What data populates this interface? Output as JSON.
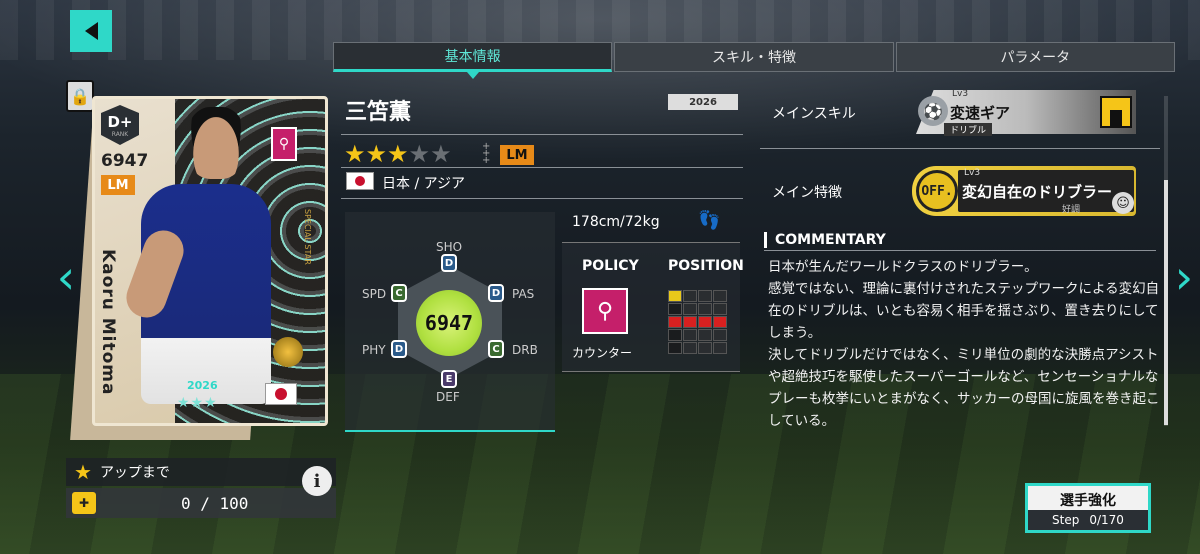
{
  "tabs": [
    {
      "label": "基本情報",
      "active": true
    },
    {
      "label": "スキル・特徴",
      "active": false
    },
    {
      "label": "パラメータ",
      "active": false
    }
  ],
  "card": {
    "rank": "D+",
    "rank_label": "RANK",
    "ovr": "6947",
    "position": "LM",
    "name": "Kaoru Mitoma",
    "year": "2026",
    "stars": "★★★",
    "special_text": "SPECIAL STAR"
  },
  "upgrade": {
    "label": "アップまで",
    "value": "0 / 100",
    "info": "i"
  },
  "player": {
    "name": "三笘薫",
    "year": "2026",
    "stars_filled": 3,
    "stars_total": 5,
    "position": "LM",
    "nation": "日本 / アジア",
    "height_weight": "178cm/72kg"
  },
  "stats": {
    "ovr": "6947",
    "labels": {
      "sho": "SHO",
      "pas": "PAS",
      "drb": "DRB",
      "def": "DEF",
      "phy": "PHY",
      "spd": "SPD"
    },
    "grades": {
      "sho": "D",
      "pas": "D",
      "drb": "C",
      "def": "E",
      "phy": "D",
      "spd": "C"
    }
  },
  "policy": {
    "header": "POLICY",
    "name": "カウンター"
  },
  "position_map": {
    "header": "POSITION"
  },
  "main_skill": {
    "label": "メインスキル",
    "level": "Lv3",
    "name": "変速ギア",
    "category": "ドリブル"
  },
  "main_trait": {
    "label": "メイン特徴",
    "badge": "OFF.",
    "level": "Lv3",
    "name": "変幻自在のドリブラー",
    "condition": "好調"
  },
  "commentary": {
    "title": "COMMENTARY",
    "paragraphs": [
      "日本が生んだワールドクラスのドリブラー。",
      "感覚ではない、理論に裏付けされたステップワークによる変幻自在のドリブルは、いとも容易く相手を揺さぶり、置き去りにしてしまう。",
      "決してドリブルだけではなく、ミリ単位の劇的な決勝点アシストや超絶技巧を駆使したスーパーゴールなど、センセーショナルなプレーも枚挙にいとまがなく、サッカーの母国に旋風を巻き起こしている。"
    ]
  },
  "enhance": {
    "title": "選手強化",
    "step_label": "Step",
    "step_value": "0/170"
  },
  "colors": {
    "accent": "#2fd8c8",
    "position_badge": "#e78a18",
    "star": "#f5c518",
    "policy": "#c51f6a"
  }
}
